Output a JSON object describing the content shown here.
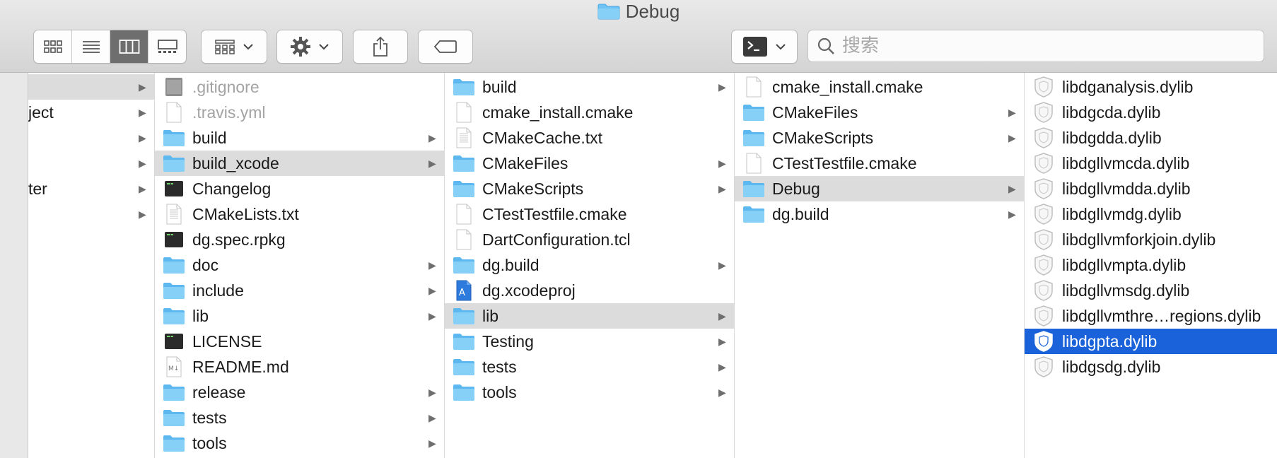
{
  "window": {
    "title": "Debug"
  },
  "toolbar": {
    "view_modes": [
      "icon-view",
      "list-view",
      "column-view",
      "gallery-view"
    ],
    "active_view": "column-view",
    "search_placeholder": "搜索"
  },
  "colors": {
    "folder": "#6ec3f4",
    "selection": "#1a62d9",
    "highlight": "#dcdcdc",
    "toolbar": "#e0e0e0"
  },
  "columns": [
    {
      "items": [
        {
          "name": "",
          "type": "partial",
          "chevron": true,
          "selected": true
        },
        {
          "name": "ject",
          "type": "partial",
          "chevron": true
        },
        {
          "name": "",
          "type": "partial",
          "chevron": true
        },
        {
          "name": "",
          "type": "partial",
          "chevron": true
        },
        {
          "name": "ter",
          "type": "partial",
          "chevron": true
        },
        {
          "name": "",
          "type": "partial",
          "chevron": true
        }
      ]
    },
    {
      "items": [
        {
          "name": ".gitignore",
          "type": "gray-doc",
          "dim": true
        },
        {
          "name": ".travis.yml",
          "type": "doc",
          "dim": true
        },
        {
          "name": "build",
          "type": "folder",
          "chevron": true
        },
        {
          "name": "build_xcode",
          "type": "folder",
          "chevron": true,
          "selected": true
        },
        {
          "name": "Changelog",
          "type": "exec"
        },
        {
          "name": "CMakeLists.txt",
          "type": "text"
        },
        {
          "name": "dg.spec.rpkg",
          "type": "exec"
        },
        {
          "name": "doc",
          "type": "folder",
          "chevron": true
        },
        {
          "name": "include",
          "type": "folder",
          "chevron": true
        },
        {
          "name": "lib",
          "type": "folder",
          "chevron": true
        },
        {
          "name": "LICENSE",
          "type": "exec"
        },
        {
          "name": "README.md",
          "type": "md"
        },
        {
          "name": "release",
          "type": "folder",
          "chevron": true
        },
        {
          "name": "tests",
          "type": "folder",
          "chevron": true
        },
        {
          "name": "tools",
          "type": "folder",
          "chevron": true
        }
      ]
    },
    {
      "items": [
        {
          "name": "build",
          "type": "folder",
          "chevron": true
        },
        {
          "name": "cmake_install.cmake",
          "type": "doc"
        },
        {
          "name": "CMakeCache.txt",
          "type": "text"
        },
        {
          "name": "CMakeFiles",
          "type": "folder",
          "chevron": true
        },
        {
          "name": "CMakeScripts",
          "type": "folder",
          "chevron": true
        },
        {
          "name": "CTestTestfile.cmake",
          "type": "doc"
        },
        {
          "name": "DartConfiguration.tcl",
          "type": "doc"
        },
        {
          "name": "dg.build",
          "type": "folder",
          "chevron": true
        },
        {
          "name": "dg.xcodeproj",
          "type": "xcode"
        },
        {
          "name": "lib",
          "type": "folder",
          "chevron": true,
          "selected": true
        },
        {
          "name": "Testing",
          "type": "folder",
          "chevron": true
        },
        {
          "name": "tests",
          "type": "folder",
          "chevron": true
        },
        {
          "name": "tools",
          "type": "folder",
          "chevron": true
        }
      ]
    },
    {
      "items": [
        {
          "name": "cmake_install.cmake",
          "type": "doc"
        },
        {
          "name": "CMakeFiles",
          "type": "folder",
          "chevron": true
        },
        {
          "name": "CMakeScripts",
          "type": "folder",
          "chevron": true
        },
        {
          "name": "CTestTestfile.cmake",
          "type": "doc"
        },
        {
          "name": "Debug",
          "type": "folder",
          "chevron": true,
          "selected": true
        },
        {
          "name": "dg.build",
          "type": "folder",
          "chevron": true
        }
      ]
    },
    {
      "items": [
        {
          "name": "libdganalysis.dylib",
          "type": "dylib"
        },
        {
          "name": "libdgcda.dylib",
          "type": "dylib"
        },
        {
          "name": "libdgdda.dylib",
          "type": "dylib"
        },
        {
          "name": "libdgllvmcda.dylib",
          "type": "dylib"
        },
        {
          "name": "libdgllvmdda.dylib",
          "type": "dylib"
        },
        {
          "name": "libdgllvmdg.dylib",
          "type": "dylib"
        },
        {
          "name": "libdgllvmforkjoin.dylib",
          "type": "dylib"
        },
        {
          "name": "libdgllvmpta.dylib",
          "type": "dylib"
        },
        {
          "name": "libdgllvmsdg.dylib",
          "type": "dylib"
        },
        {
          "name": "libdgllvmthre…regions.dylib",
          "type": "dylib"
        },
        {
          "name": "libdgpta.dylib",
          "type": "dylib",
          "active": true
        },
        {
          "name": "libdgsdg.dylib",
          "type": "dylib"
        }
      ]
    }
  ]
}
